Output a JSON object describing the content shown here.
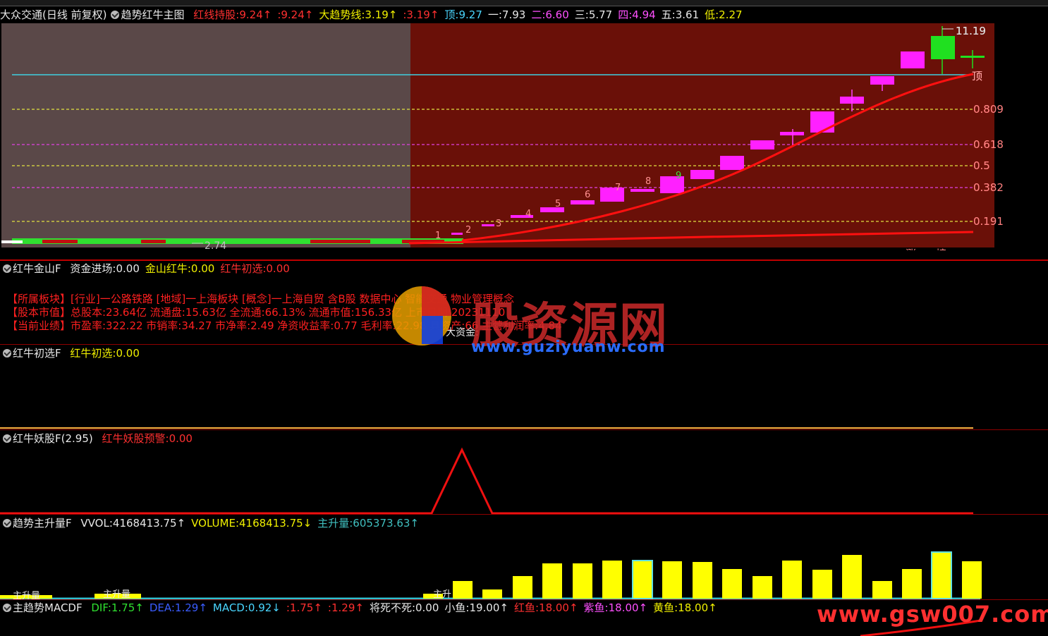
{
  "header": {
    "stock": "大众交通(日线 前复权)",
    "indicator": "趋势红牛主图",
    "items": [
      {
        "label": "红线持股:",
        "value": "9.24↑",
        "color": "#ff3030"
      },
      {
        "label": "",
        "value": ":9.24↑",
        "color": "#ff3030"
      },
      {
        "label": "大趋势线:",
        "value": "3.19↑",
        "color": "#f0f000"
      },
      {
        "label": "",
        "value": ":3.19↑",
        "color": "#ff3030"
      },
      {
        "label": "顶:",
        "value": "9.27",
        "color": "#4ad6ff"
      },
      {
        "label": "一:",
        "value": "7.93",
        "color": "#e8e8e8"
      },
      {
        "label": "二:",
        "value": "6.60",
        "color": "#ff50ff"
      },
      {
        "label": "三:",
        "value": "5.77",
        "color": "#e8e8e8"
      },
      {
        "label": "四:",
        "value": "4.94",
        "color": "#ff50ff"
      },
      {
        "label": "五:",
        "value": "3.61",
        "color": "#e8e8e8"
      },
      {
        "label": "低:",
        "value": "2.27",
        "color": "#f0f000"
      }
    ]
  },
  "main_chart": {
    "high_label": "11.19",
    "low_label": "2.74",
    "top_label": "顶",
    "levels": [
      "0.809",
      "0.618",
      "0.5",
      "0.382",
      "0.191"
    ],
    "wave_labels": [
      "1",
      "2",
      "3",
      "4",
      "5",
      "6",
      "7",
      "8",
      "9"
    ],
    "bottom_tags": [
      "涨",
      "榜"
    ]
  },
  "panel1": {
    "title": "红牛金山F",
    "items": [
      {
        "label": "资金进场:",
        "value": "0.00",
        "color": "#e8e8e8"
      },
      {
        "label": "金山红牛:",
        "value": "0.00",
        "color": "#f0f000"
      },
      {
        "label": "红牛初选:",
        "value": "0.00",
        "color": "#ff3030"
      }
    ],
    "info_lines": [
      "【所属板块】[行业]一公路铁路 [地域]一上海板块 [概念]一上海自贸 含B股 数据中心 智能交通 物业管理概念",
      "【股本市值】总股本:23.64亿 流通盘:15.63亿 全流通:66.13% 流通市值:156.33亿 上市日期:20231110",
      "【当前业绩】市盈率:322.22 市销率:34.27 市净率:2.49 净资收益率:0.77 毛利率:22.98 具资产:66 主营利润率:4.84"
    ],
    "fund_label": "大资金:"
  },
  "panel2": {
    "title": "红牛初选F",
    "items": [
      {
        "label": "红牛初选:",
        "value": "0.00",
        "color": "#f0f000"
      }
    ]
  },
  "panel3": {
    "title": "红牛妖股F(2.95)",
    "items": [
      {
        "label": "红牛妖股预警:",
        "value": "0.00",
        "color": "#ff3030"
      }
    ]
  },
  "panel4": {
    "title": "趋势主升量F",
    "items": [
      {
        "label": "VVOL:",
        "value": "4168413.75↑",
        "color": "#e8e8e8"
      },
      {
        "label": "VOLUME:",
        "value": "4168413.75↓",
        "color": "#f0f000"
      },
      {
        "label": "主升量:",
        "value": "605373.63↑",
        "color": "#40c0c0"
      }
    ],
    "bar_tags": [
      "主升量",
      "主升量",
      "主升"
    ]
  },
  "panel5": {
    "title": "主趋势MACDF",
    "items": [
      {
        "label": "DIF:",
        "value": "1.75↑",
        "color": "#30e030"
      },
      {
        "label": "DEA:",
        "value": "1.29↑",
        "color": "#3a5cff"
      },
      {
        "label": "MACD:",
        "value": "0.92↓",
        "color": "#4ad6ff"
      },
      {
        "label": "",
        "value": ":1.75↑",
        "color": "#ff3030"
      },
      {
        "label": "",
        "value": ":1.29↑",
        "color": "#ff3030"
      },
      {
        "label": "将死不死:",
        "value": "0.00",
        "color": "#e8e8e8"
      },
      {
        "label": "小鱼:",
        "value": "19.00↑",
        "color": "#e8e8e8"
      },
      {
        "label": "红鱼:",
        "value": "18.00↑",
        "color": "#ff3030"
      },
      {
        "label": "紫鱼:",
        "value": "18.00↑",
        "color": "#ff50ff"
      },
      {
        "label": "黄鱼:",
        "value": "18.00↑",
        "color": "#f0f000"
      }
    ]
  },
  "watermark": {
    "site_name": "股资源网",
    "site_url": "www.guziyuanw.com",
    "footer_url": "www.gsw007.com"
  }
}
